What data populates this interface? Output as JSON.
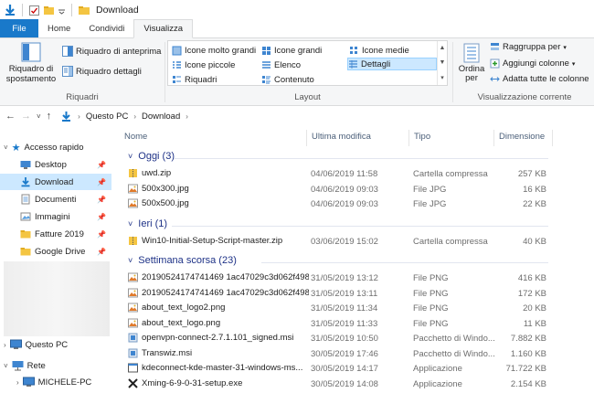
{
  "window": {
    "title": "Download"
  },
  "ribbon": {
    "tabs": [
      "File",
      "Home",
      "Condividi",
      "Visualizza"
    ],
    "active_tab": "Visualizza",
    "panes": {
      "nav_pane_label": "Riquadro di spostamento",
      "preview": "Riquadro di anteprima",
      "details": "Riquadro dettagli",
      "group": "Riquadri"
    },
    "layout": {
      "items": [
        "Icone molto grandi",
        "Icone grandi",
        "Icone medie",
        "Icone piccole",
        "Elenco",
        "Dettagli",
        "Riquadri",
        "Contenuto"
      ],
      "selected": "Dettagli",
      "group": "Layout"
    },
    "current_view": {
      "sort_label": "Ordina per",
      "group_by": "Raggruppa per",
      "add_columns": "Aggiungi colonne",
      "fit_columns": "Adatta tutte le colonne",
      "group": "Visualizzazione corrente"
    }
  },
  "address": {
    "crumbs": [
      "Questo PC",
      "Download"
    ]
  },
  "sidebar": {
    "quick_access": "Accesso rapido",
    "items": [
      "Desktop",
      "Download",
      "Documenti",
      "Immagini",
      "Fatture 2019",
      "Google Drive"
    ],
    "selected": "Download",
    "this_pc": "Questo PC",
    "network": "Rete",
    "network_child": "MICHELE-PC"
  },
  "columns": {
    "name": "Nome",
    "modified": "Ultima modifica",
    "type": "Tipo",
    "size": "Dimensione"
  },
  "groups": [
    {
      "title": "Oggi (3)",
      "rows": [
        {
          "name": "uwd.zip",
          "date": "04/06/2019 11:58",
          "type": "Cartella compressa",
          "size": "257 KB",
          "icon": "zip-icon"
        },
        {
          "name": "500x300.jpg",
          "date": "04/06/2019 09:03",
          "type": "File JPG",
          "size": "16 KB",
          "icon": "image-icon"
        },
        {
          "name": "500x500.jpg",
          "date": "04/06/2019 09:03",
          "type": "File JPG",
          "size": "22 KB",
          "icon": "image-icon"
        }
      ]
    },
    {
      "title": "Ieri (1)",
      "rows": [
        {
          "name": "Win10-Initial-Setup-Script-master.zip",
          "date": "03/06/2019 15:02",
          "type": "Cartella compressa",
          "size": "40 KB",
          "icon": "zip-icon"
        }
      ]
    },
    {
      "title": "Settimana scorsa (23)",
      "rows": [
        {
          "name": "20190524174741469 1ac47029c3d062f498b...",
          "date": "31/05/2019 13:12",
          "type": "File PNG",
          "size": "416 KB",
          "icon": "image-icon"
        },
        {
          "name": "20190524174741469 1ac47029c3d062f498b...",
          "date": "31/05/2019 13:11",
          "type": "File PNG",
          "size": "172 KB",
          "icon": "image-icon"
        },
        {
          "name": "about_text_logo2.png",
          "date": "31/05/2019 11:34",
          "type": "File PNG",
          "size": "20 KB",
          "icon": "image-icon"
        },
        {
          "name": "about_text_logo.png",
          "date": "31/05/2019 11:33",
          "type": "File PNG",
          "size": "11 KB",
          "icon": "image-icon"
        },
        {
          "name": "openvpn-connect-2.7.1.101_signed.msi",
          "date": "31/05/2019 10:50",
          "type": "Pacchetto di Windo...",
          "size": "7.882 KB",
          "icon": "msi-icon"
        },
        {
          "name": "Transwiz.msi",
          "date": "30/05/2019 17:46",
          "type": "Pacchetto di Windo...",
          "size": "1.160 KB",
          "icon": "msi-icon"
        },
        {
          "name": "kdeconnect-kde-master-31-windows-ms...",
          "date": "30/05/2019 14:17",
          "type": "Applicazione",
          "size": "71.722 KB",
          "icon": "app-icon"
        },
        {
          "name": "Xming-6-9-0-31-setup.exe",
          "date": "30/05/2019 14:08",
          "type": "Applicazione",
          "size": "2.154 KB",
          "icon": "xming-icon"
        }
      ]
    }
  ],
  "colors": {
    "accent": "#1979ca",
    "group_header": "#1e3287",
    "selection": "#cce8ff",
    "folder": "#f4c542"
  }
}
